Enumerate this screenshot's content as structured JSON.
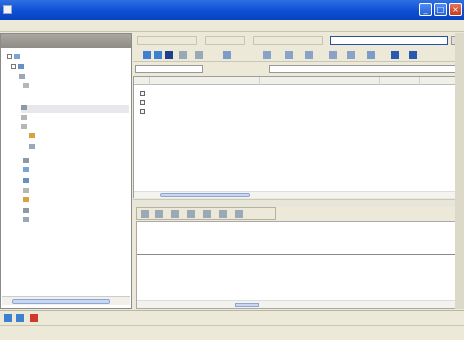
{
  "window": {
    "title": "",
    "controls": {
      "minimize": "_",
      "maximize": "□",
      "close": "×"
    }
  },
  "menubar": {
    "items": [
      "",
      "",
      ""
    ]
  },
  "left_pane": {
    "header": "",
    "tree": [
      {
        "label": "",
        "selected": false
      },
      {
        "label": "",
        "selected": false
      },
      {
        "label": "",
        "selected": false
      },
      {
        "label": "",
        "selected": false
      },
      {
        "label": "",
        "selected": true
      },
      {
        "label": "",
        "selected": false
      },
      {
        "label": "",
        "selected": false
      },
      {
        "label": "",
        "selected": false
      },
      {
        "label": "",
        "selected": false
      },
      {
        "label": "",
        "selected": false
      },
      {
        "label": "",
        "selected": false
      },
      {
        "label": "",
        "selected": false
      },
      {
        "label": "",
        "selected": false
      },
      {
        "label": "",
        "selected": false
      },
      {
        "label": "",
        "selected": false
      },
      {
        "label": "",
        "selected": false
      }
    ]
  },
  "top_toolbar": {
    "search_value": "",
    "go_label": ""
  },
  "filter_bar": {
    "field1": "",
    "field2": ""
  },
  "grid": {
    "columns": [
      "",
      "",
      "",
      "",
      ""
    ],
    "rows": [
      [
        "",
        "",
        "",
        "",
        ""
      ],
      [
        "",
        "",
        "",
        "",
        ""
      ],
      [
        "",
        "",
        "",
        "",
        ""
      ]
    ]
  },
  "detail": {
    "lines": [
      "",
      "",
      ""
    ]
  },
  "nav_bar": {
    "label": ""
  },
  "status_bar": {
    "segments": [
      "",
      "",
      ""
    ]
  },
  "colors": {
    "titlebar": "#0d4fd6",
    "chrome": "#ece9d8",
    "selection": "#e8e8ea",
    "accent_red": "#d03a2a"
  }
}
